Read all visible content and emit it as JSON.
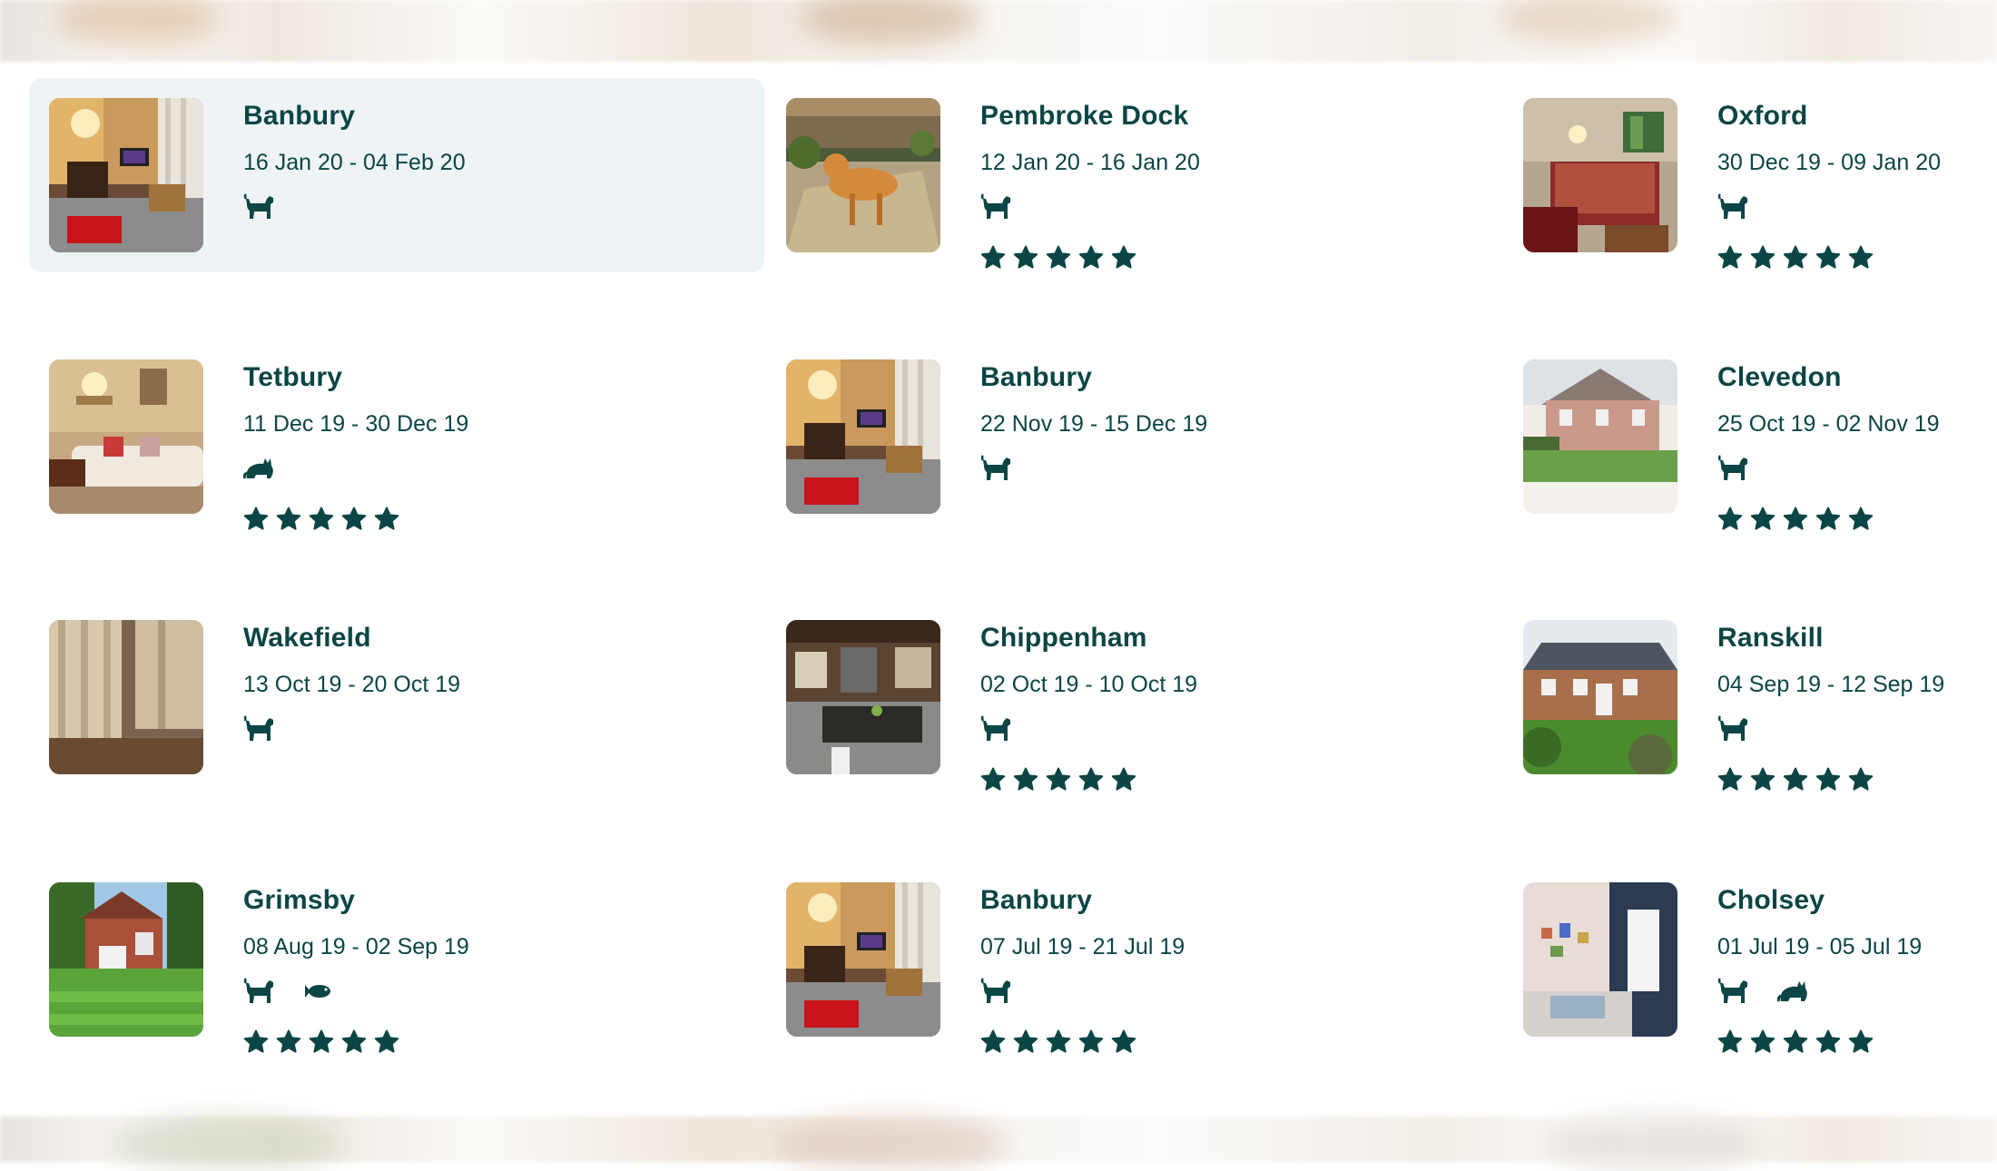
{
  "colors": {
    "primary": "#0b4546",
    "selected_bg": "#eef3f5"
  },
  "stays": [
    {
      "city": "Banbury",
      "dates": "16 Jan 20 - 04 Feb 20",
      "pets": [
        "dog-icon"
      ],
      "rating": 0,
      "selected": true,
      "photo": "living-room"
    },
    {
      "city": "Pembroke Dock",
      "dates": "12 Jan 20 - 16 Jan 20",
      "pets": [
        "dog-icon"
      ],
      "rating": 5,
      "selected": false,
      "photo": "dog-garden"
    },
    {
      "city": "Oxford",
      "dates": "30 Dec 19 - 09 Jan 20",
      "pets": [
        "dog-icon"
      ],
      "rating": 5,
      "selected": false,
      "photo": "bedroom"
    },
    {
      "city": "Tetbury",
      "dates": "11 Dec 19 - 30 Dec 19",
      "pets": [
        "cat-icon"
      ],
      "rating": 5,
      "selected": false,
      "photo": "lounge-sofa"
    },
    {
      "city": "Banbury",
      "dates": "22 Nov 19 - 15 Dec 19",
      "pets": [
        "dog-icon"
      ],
      "rating": 0,
      "selected": false,
      "photo": "living-room"
    },
    {
      "city": "Clevedon",
      "dates": "25 Oct 19 - 02 Nov 19",
      "pets": [
        "dog-icon"
      ],
      "rating": 5,
      "selected": false,
      "photo": "house-exterior"
    },
    {
      "city": "Wakefield",
      "dates": "13 Oct 19 - 20 Oct 19",
      "pets": [
        "dog-icon"
      ],
      "rating": 0,
      "selected": false,
      "photo": "curtains"
    },
    {
      "city": "Chippenham",
      "dates": "02 Oct 19 - 10 Oct 19",
      "pets": [
        "dog-icon"
      ],
      "rating": 5,
      "selected": false,
      "photo": "kitchen"
    },
    {
      "city": "Ranskill",
      "dates": "04 Sep 19 - 12 Sep 19",
      "pets": [
        "dog-icon"
      ],
      "rating": 5,
      "selected": false,
      "photo": "brick-house"
    },
    {
      "city": "Grimsby",
      "dates": "08 Aug 19 - 02 Sep 19",
      "pets": [
        "dog-icon",
        "fish-icon"
      ],
      "rating": 5,
      "selected": false,
      "photo": "garden-house"
    },
    {
      "city": "Banbury",
      "dates": "07 Jul 19 - 21 Jul 19",
      "pets": [
        "dog-icon"
      ],
      "rating": 5,
      "selected": false,
      "photo": "living-room"
    },
    {
      "city": "Cholsey",
      "dates": "01 Jul 19 - 05 Jul 19",
      "pets": [
        "dog-icon",
        "cat-icon"
      ],
      "rating": 5,
      "selected": false,
      "photo": "bright-lounge"
    }
  ]
}
